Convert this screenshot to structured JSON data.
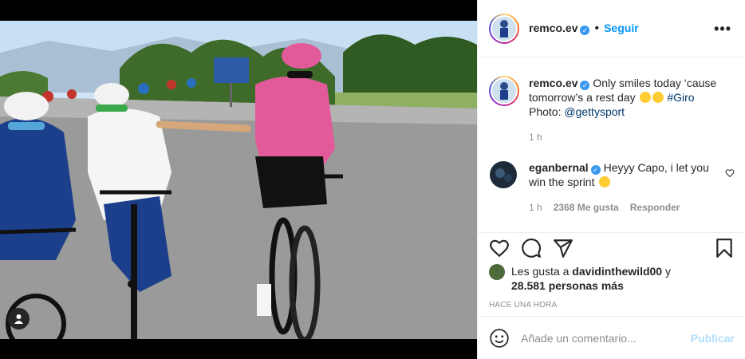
{
  "header": {
    "username": "remco.ev",
    "separator": "•",
    "follow_label": "Seguir",
    "more_label": "•••"
  },
  "caption": {
    "username": "remco.ev",
    "text": "Only smiles today ‘cause tomorrow’s a rest day",
    "hashtag": "#Giro",
    "photo_prefix": "Photo:",
    "photo_credit": "@gettysport",
    "time": "1 h"
  },
  "comments": [
    {
      "username": "eganbernal",
      "text": "Heyyy Capo, i let you win the sprint",
      "time": "1 h",
      "likes": "2368 Me gusta",
      "reply_label": "Responder"
    }
  ],
  "likes": {
    "prefix": "Les gusta a",
    "user": "davidinthewild00",
    "connector": "y",
    "others": "28.581 personas más"
  },
  "timestamp": "HACE UNA HORA",
  "composer": {
    "placeholder": "Añade un comentario...",
    "publish_label": "Publicar"
  },
  "colors": {
    "follow_blue": "#0095f6",
    "verified_blue": "#3897f0",
    "publish_disabled": "#b2dffc"
  }
}
